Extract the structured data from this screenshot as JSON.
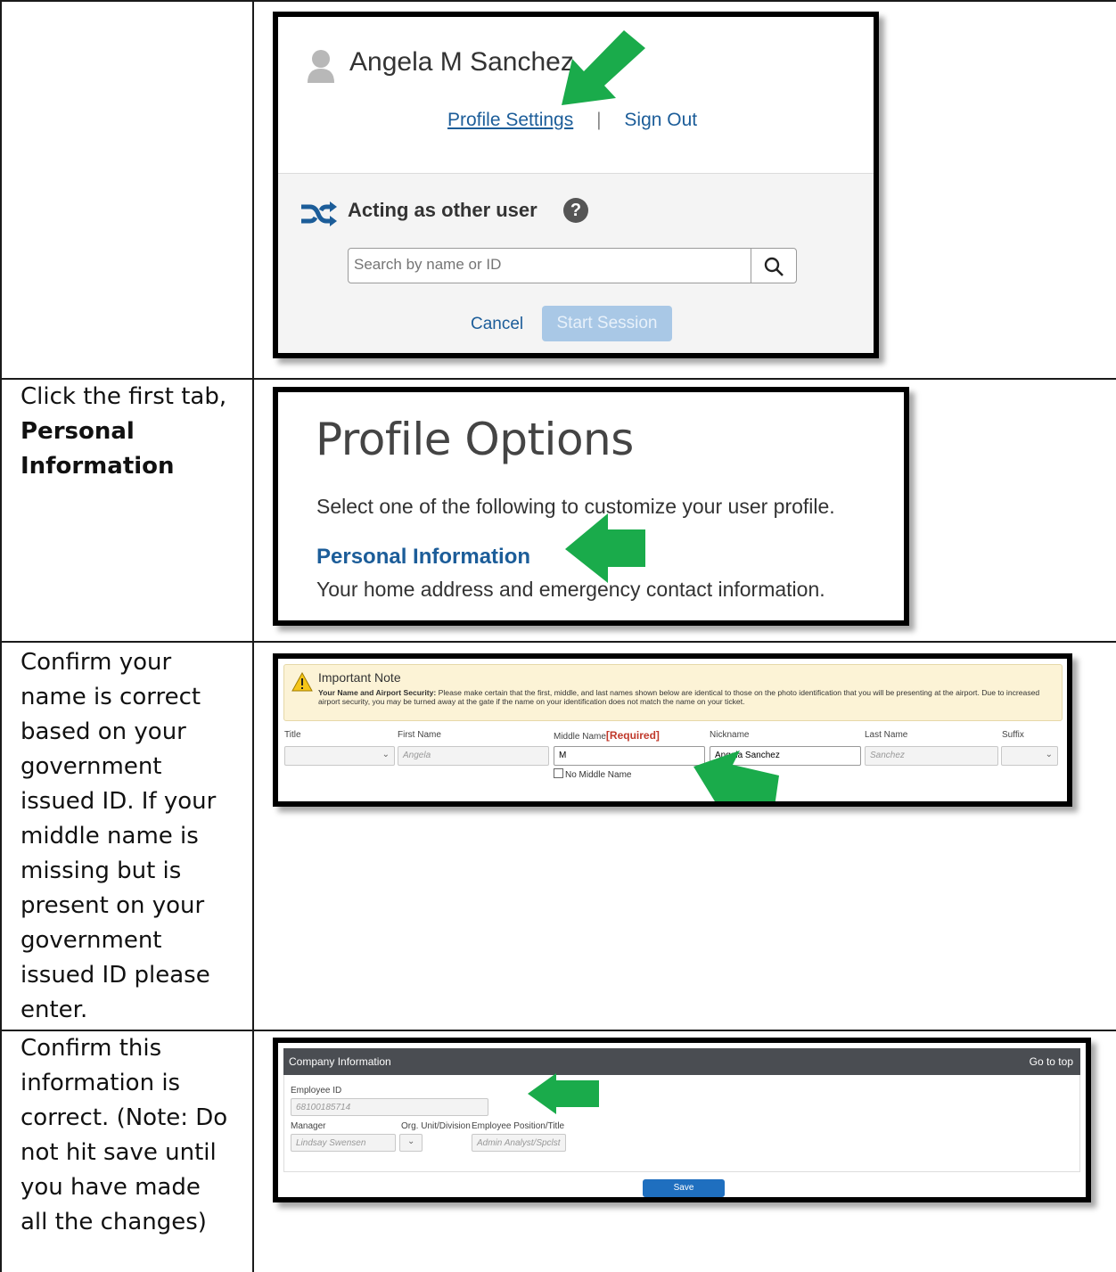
{
  "steps": [
    {
      "instruction": ""
    },
    {
      "instruction_pre": "Click the first tab, ",
      "instruction_bold": "Personal Information"
    },
    {
      "instruction": "Confirm your name is correct based on your government issued ID. If your middle name is missing but is present on your government issued ID please enter."
    },
    {
      "instruction": "Confirm this information is correct. (Note: Do not hit save until you have made all the changes)"
    }
  ],
  "profile_menu": {
    "user_name": "Angela M Sanchez",
    "profile_settings": "Profile Settings",
    "separator": "|",
    "sign_out": "Sign Out",
    "acting_title": "Acting as other user",
    "search_placeholder": "Search by name or ID",
    "cancel": "Cancel",
    "start_session": "Start Session"
  },
  "profile_options": {
    "title": "Profile Options",
    "subtitle": "Select one of the following to customize your user profile.",
    "personal_info_link": "Personal Information",
    "personal_info_desc": "Your home address and emergency contact information."
  },
  "name_form": {
    "note_title": "Important Note",
    "note_bold": "Your Name and Airport Security:",
    "note_text": " Please make certain that the first, middle, and last names shown below are identical to those on the photo identification that you will be presenting at the airport. Due to increased airport security, you may be turned away at the gate if the name on your identification does not match the name on your ticket.",
    "labels": {
      "title": "Title",
      "first_name": "First Name",
      "middle_name": "Middle Name",
      "required": "[Required]",
      "nickname": "Nickname",
      "last_name": "Last Name",
      "suffix": "Suffix"
    },
    "values": {
      "first_name": "Angela",
      "middle_name": "M",
      "nickname": "Angela Sanchez",
      "last_name": "Sanchez"
    },
    "no_middle_name": "No Middle Name"
  },
  "company_info": {
    "header": "Company Information",
    "go_to_top": "Go to top",
    "employee_id_label": "Employee ID",
    "employee_id": "68100185714",
    "manager_label": "Manager",
    "manager": "Lindsay Swensen",
    "org_unit_label": "Org. Unit/Division",
    "position_label": "Employee Position/Title",
    "position": "Admin Analyst/Spclst",
    "save": "Save"
  },
  "colors": {
    "arrow": "#1aab4b",
    "link": "#1c5d99",
    "required": "#c0392b"
  }
}
